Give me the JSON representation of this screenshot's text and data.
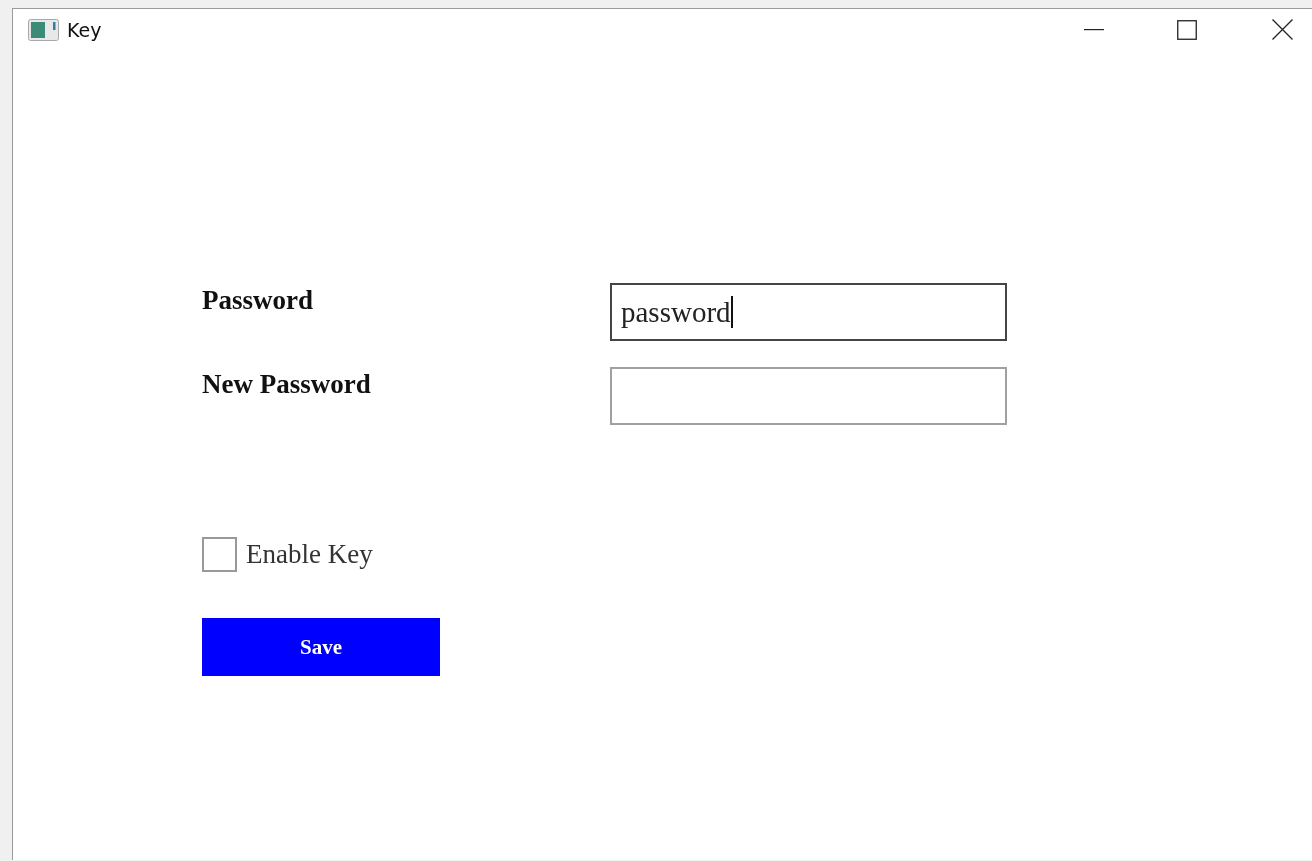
{
  "window": {
    "title": "Key"
  },
  "fields": [
    {
      "label": "Password",
      "value": "password",
      "focused": true
    },
    {
      "label": "New Password",
      "focused": false
    }
  ],
  "checkbox": {
    "label": "Enable Key",
    "checked": false
  },
  "buttons": [
    "Save"
  ]
}
